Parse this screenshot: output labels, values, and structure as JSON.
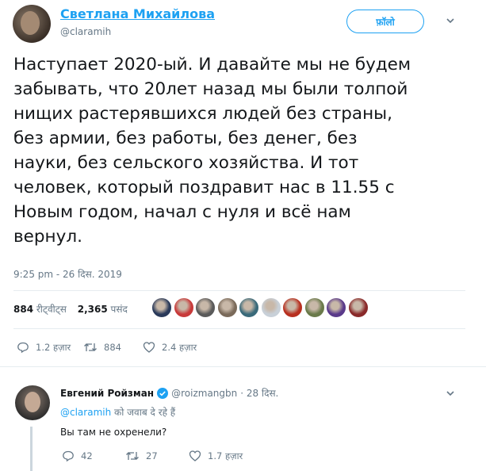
{
  "author": {
    "name": "Светлана Михайлова",
    "handle": "@claramih",
    "follow_label": "फ़ॉलो"
  },
  "tweet": {
    "text": "Наступает 2020-ый. И давайте мы не будем\nзабывать, что 20лет назад мы были толпой\nнищих растерявшихся людей без страны,\nбез армии, без работы, без денег, без\nнауки, без сельского хозяйства. И тот\nчеловек, который поздравит нас в 11.55 с\nНовым годом, начал с нуля и всё нам\nвернул.",
    "timestamp": "9:25 pm - 26 दिस. 2019"
  },
  "stats": {
    "retweets_count": "884",
    "retweets_label": "रीट्वीट्स",
    "likes_count": "2,365",
    "likes_label": "पसंद",
    "liker_colors": [
      "#2a3a5a",
      "#c83a3a",
      "#5a5a5a",
      "#7a6a5a",
      "#3a6a7a",
      "#c8d0d8",
      "#b83020",
      "#6a7a4a",
      "#5a3a8a",
      "#8a2a2a"
    ]
  },
  "actions": {
    "reply_count": "1.2 हज़ार",
    "retweet_count": "884",
    "like_count": "2.4 हज़ार",
    "icons": [
      "reply-icon",
      "retweet-icon",
      "heart-icon",
      "envelope-icon"
    ]
  },
  "reply": {
    "name": "Евгений Ройзман",
    "handle": "@roizmangbn",
    "date": "· 28 दिस.",
    "replying_handle": "@claramih",
    "replying_suffix": " को जवाब दे रहे हैं",
    "text": "Вы там не охренели?",
    "reply_count": "42",
    "retweet_count": "27",
    "like_count": "1.7 हज़ार"
  },
  "colors": {
    "accent": "#1da1f2",
    "muted": "#657786",
    "text": "#14171a"
  }
}
